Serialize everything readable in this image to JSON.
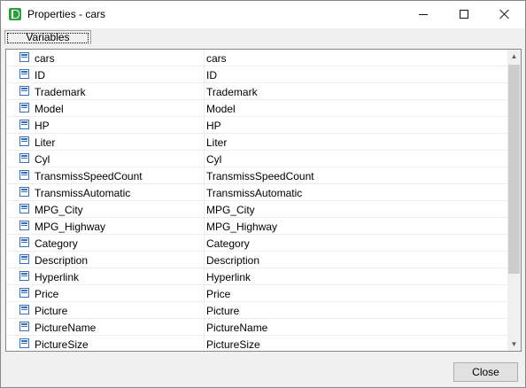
{
  "window": {
    "title": "Properties - cars"
  },
  "tabs": [
    {
      "label": "Variables"
    }
  ],
  "variables": [
    {
      "name": "cars",
      "alias": "cars"
    },
    {
      "name": "ID",
      "alias": "ID"
    },
    {
      "name": "Trademark",
      "alias": "Trademark"
    },
    {
      "name": "Model",
      "alias": "Model"
    },
    {
      "name": "HP",
      "alias": "HP"
    },
    {
      "name": "Liter",
      "alias": "Liter"
    },
    {
      "name": "Cyl",
      "alias": "Cyl"
    },
    {
      "name": "TransmissSpeedCount",
      "alias": "TransmissSpeedCount"
    },
    {
      "name": "TransmissAutomatic",
      "alias": "TransmissAutomatic"
    },
    {
      "name": "MPG_City",
      "alias": "MPG_City"
    },
    {
      "name": "MPG_Highway",
      "alias": "MPG_Highway"
    },
    {
      "name": "Category",
      "alias": "Category"
    },
    {
      "name": "Description",
      "alias": "Description"
    },
    {
      "name": "Hyperlink",
      "alias": "Hyperlink"
    },
    {
      "name": "Price",
      "alias": "Price"
    },
    {
      "name": "Picture",
      "alias": "Picture"
    },
    {
      "name": "PictureName",
      "alias": "PictureName"
    },
    {
      "name": "PictureSize",
      "alias": "PictureSize"
    }
  ],
  "buttons": {
    "close_label": "Close"
  },
  "icons": {
    "app": "app-logo-icon",
    "variable": "field-table-icon",
    "minimize": "minimize-icon",
    "maximize": "maximize-icon",
    "close": "close-icon",
    "scroll_up": "chevron-up-icon",
    "scroll_down": "chevron-down-icon"
  },
  "colors": {
    "accent": "#2e9e3e",
    "field_icon": "#3a6fb5"
  }
}
